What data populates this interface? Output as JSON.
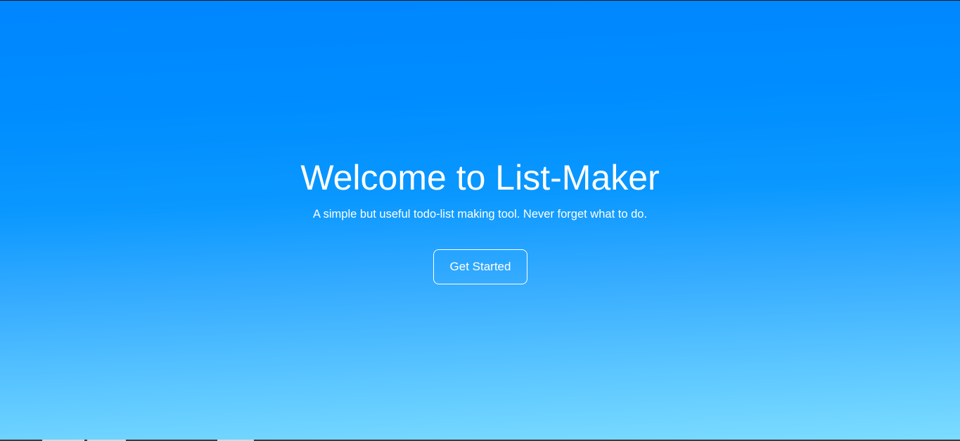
{
  "hero": {
    "title": "Welcome to List-Maker",
    "subtitle": "A simple but useful todo-list making tool. Never forget what to do.",
    "cta_label": "Get Started"
  },
  "colors": {
    "gradient_top": "#0086ff",
    "gradient_bottom": "#7bdcff",
    "text": "#ffffff"
  }
}
